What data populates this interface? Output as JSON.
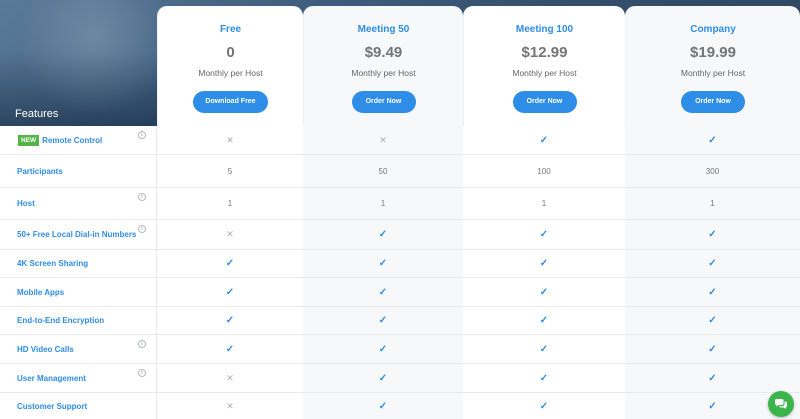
{
  "header": {
    "features_label": "Features"
  },
  "plans": [
    {
      "name": "Free",
      "price": "0",
      "period": "Monthly per Host",
      "button": "Download Free"
    },
    {
      "name": "Meeting 50",
      "price": "$9.49",
      "period": "Monthly per Host",
      "button": "Order Now"
    },
    {
      "name": "Meeting 100",
      "price": "$12.99",
      "period": "Monthly per Host",
      "button": "Order Now"
    },
    {
      "name": "Company",
      "price": "$19.99",
      "period": "Monthly per Host",
      "button": "Order Now"
    }
  ],
  "badge": {
    "new": "NEW"
  },
  "features": [
    {
      "label": "Remote Control",
      "new": true,
      "info": true,
      "values": [
        "x",
        "x",
        "check",
        "check"
      ]
    },
    {
      "label": "Participants",
      "new": false,
      "info": false,
      "values": [
        "5",
        "50",
        "100",
        "300"
      ]
    },
    {
      "label": "Host",
      "new": false,
      "info": true,
      "values": [
        "1",
        "1",
        "1",
        "1"
      ]
    },
    {
      "label": "50+ Free Local Dial-in Numbers",
      "new": false,
      "info": true,
      "values": [
        "x",
        "check",
        "check",
        "check"
      ]
    },
    {
      "label": "4K Screen Sharing",
      "new": false,
      "info": false,
      "values": [
        "check",
        "check",
        "check",
        "check"
      ]
    },
    {
      "label": "Mobile Apps",
      "new": false,
      "info": false,
      "values": [
        "check",
        "check",
        "check",
        "check"
      ]
    },
    {
      "label": "End-to-End Encryption",
      "new": false,
      "info": false,
      "values": [
        "check",
        "check",
        "check",
        "check"
      ]
    },
    {
      "label": "HD Video Calls",
      "new": false,
      "info": true,
      "values": [
        "check",
        "check",
        "check",
        "check"
      ]
    },
    {
      "label": "User Management",
      "new": false,
      "info": true,
      "values": [
        "x",
        "check",
        "check",
        "check"
      ]
    },
    {
      "label": "Customer Support",
      "new": false,
      "info": false,
      "values": [
        "x",
        "check",
        "check",
        "check"
      ]
    }
  ],
  "icons": {
    "check": "check-icon",
    "x": "cross-icon",
    "info": "info-icon",
    "chat": "chat-icon"
  },
  "colors": {
    "accent": "#2e8de6",
    "badge": "#51b548",
    "chat": "#3bb54a"
  }
}
